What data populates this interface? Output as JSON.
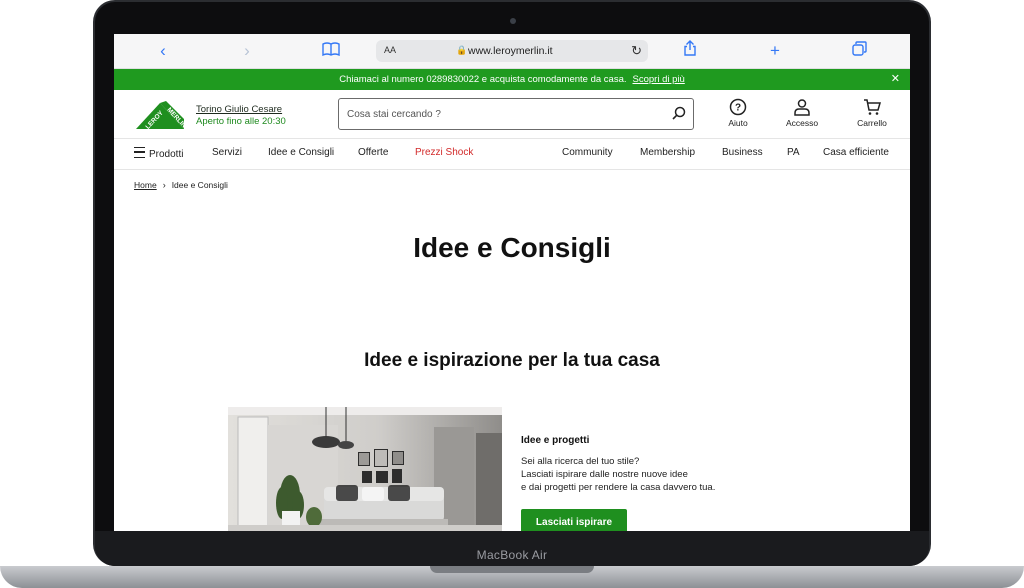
{
  "device": {
    "label": "MacBook Air"
  },
  "browser": {
    "text_size_label": "AA",
    "url": "www.leroymerlin.it",
    "icons": [
      "back-icon",
      "forward-icon",
      "bookmarks-icon",
      "lock-icon",
      "reload-icon",
      "share-icon",
      "new-tab-icon",
      "tabs-icon"
    ]
  },
  "promo": {
    "message": "Chiamaci al numero 0289830022 e acquista comodamente da casa.",
    "link": "Scopri di più",
    "close": "✕",
    "color": "#1f9a1f"
  },
  "header": {
    "logo_text": "LEROY MERLIN",
    "store_name": "Torino Giulio Cesare",
    "store_hours": "Aperto fino alle 20:30",
    "search_placeholder": "Cosa stai cercando ?",
    "actions": {
      "help": "Aiuto",
      "account": "Accesso",
      "cart": "Carrello"
    }
  },
  "nav": {
    "items": [
      "Prodotti",
      "Servizi",
      "Idee e Consigli",
      "Offerte",
      "Prezzi Shock",
      "Community",
      "Membership",
      "Business",
      "PA",
      "Casa efficiente"
    ],
    "highlight_color": "#d22a2a"
  },
  "breadcrumb": {
    "home": "Home",
    "current": "Idee e Consigli"
  },
  "main": {
    "title": "Idee e Consigli",
    "section_title": "Idee e ispirazione per la tua casa",
    "card": {
      "title": "Idee e progetti",
      "lines": [
        "Sei alla ricerca del tuo stile?",
        "Lasciati ispirare dalle nostre nuove idee",
        "e dai progetti per rendere la casa davvero tua."
      ],
      "button": "Lasciati ispirare"
    }
  },
  "brand_color": "#1f8f1f"
}
